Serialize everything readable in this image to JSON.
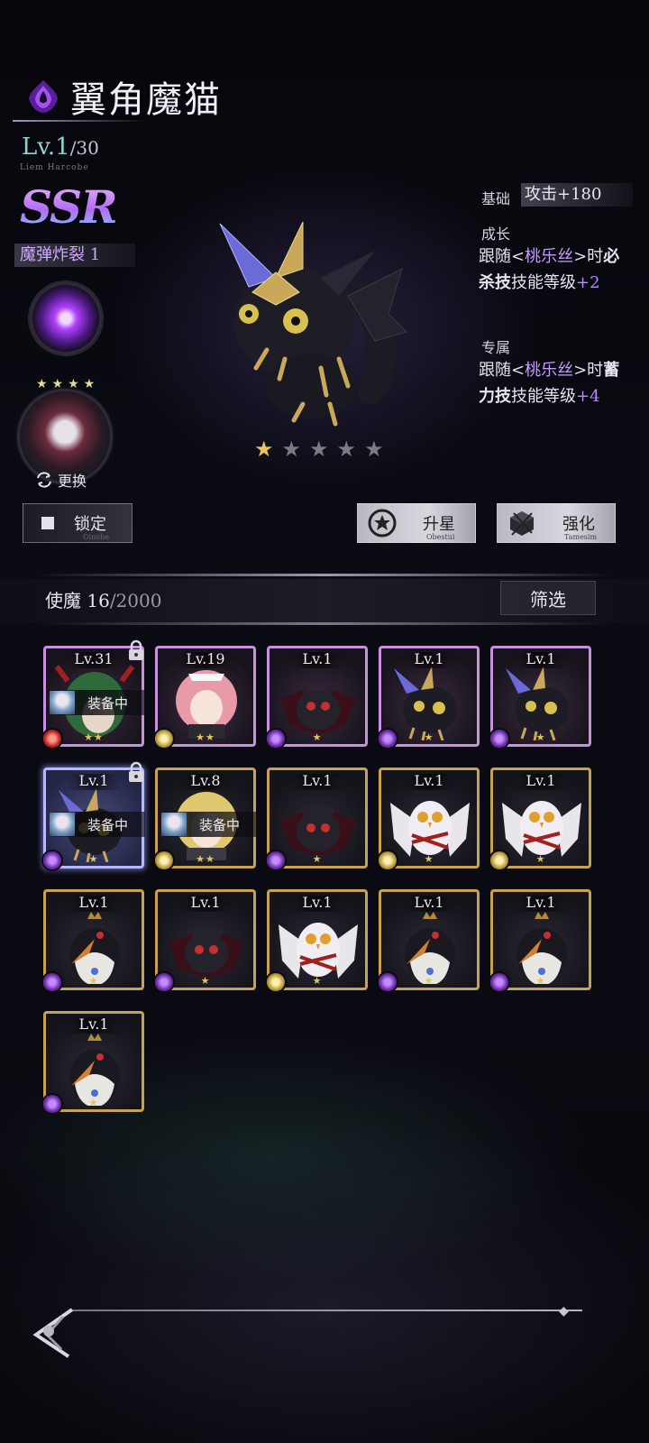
{
  "header": {
    "title": "翼角魔猫",
    "level": "Lv.1",
    "level_max": "/30",
    "subname": "Liem Harcobe",
    "rarity": "SSR",
    "skill_name": "魔弹炸裂 1"
  },
  "owner": {
    "stars": "★★★★",
    "change_label": "更换",
    "change_icon": "swap-icon"
  },
  "stats": {
    "base_label": "基础",
    "base_value": "攻击+180",
    "growth_label": "成长",
    "growth_pre": "跟随<",
    "growth_name": "桃乐丝",
    "growth_mid": ">时",
    "growth_bold1": "必",
    "growth_bold2": "杀技",
    "growth_post": "技能等级",
    "growth_bonus": "+2",
    "excl_label": "专属",
    "excl_pre": "跟随<",
    "excl_name": "桃乐丝",
    "excl_mid": ">时",
    "excl_bold1": "蓄",
    "excl_bold2": "力技",
    "excl_post": "技能等级",
    "excl_bonus": "+4"
  },
  "hero": {
    "stars_filled": 1,
    "stars_total": 5,
    "star_glyph": "★"
  },
  "actions": {
    "lock_label": "锁定",
    "lock_sub": "Oinobe",
    "upgrade_label": "升星",
    "upgrade_sub": "Obestui",
    "enhance_label": "强化",
    "enhance_sub": "Tamesim"
  },
  "list": {
    "title": "使魔",
    "count": "16",
    "max": "/2000",
    "filter_label": "筛选",
    "equip_label": "装备中",
    "cards": [
      {
        "lv": "Lv.31",
        "stars": "★★",
        "type": "fire",
        "frame": "purple",
        "art": "girl-green",
        "locked": true,
        "equip": true
      },
      {
        "lv": "Lv.19",
        "stars": "★★",
        "type": "light",
        "frame": "purple",
        "art": "maid",
        "locked": false,
        "equip": false
      },
      {
        "lv": "Lv.1",
        "stars": "★",
        "type": "dark",
        "frame": "purple",
        "art": "bat",
        "locked": false,
        "equip": false
      },
      {
        "lv": "Lv.1",
        "stars": "★",
        "type": "dark",
        "frame": "purple",
        "art": "cat",
        "locked": false,
        "equip": false
      },
      {
        "lv": "Lv.1",
        "stars": "★",
        "type": "dark",
        "frame": "purple",
        "art": "cat",
        "locked": false,
        "equip": false
      },
      {
        "lv": "Lv.1",
        "stars": "★",
        "type": "dark",
        "frame": "selected",
        "art": "cat",
        "locked": true,
        "equip": true
      },
      {
        "lv": "Lv.8",
        "stars": "★★",
        "type": "light",
        "frame": "gold",
        "art": "blonde",
        "locked": false,
        "equip": true
      },
      {
        "lv": "Lv.1",
        "stars": "★",
        "type": "dark",
        "frame": "gold",
        "art": "bat",
        "locked": false,
        "equip": false
      },
      {
        "lv": "Lv.1",
        "stars": "★",
        "type": "light",
        "frame": "gold",
        "art": "owl",
        "locked": false,
        "equip": false
      },
      {
        "lv": "Lv.1",
        "stars": "★",
        "type": "light",
        "frame": "gold",
        "art": "owl",
        "locked": false,
        "equip": false
      },
      {
        "lv": "Lv.1",
        "stars": "★",
        "type": "dark",
        "frame": "gold",
        "art": "crow",
        "locked": false,
        "equip": false
      },
      {
        "lv": "Lv.1",
        "stars": "★",
        "type": "dark",
        "frame": "gold",
        "art": "bat",
        "locked": false,
        "equip": false
      },
      {
        "lv": "Lv.1",
        "stars": "★",
        "type": "light",
        "frame": "gold",
        "art": "owl",
        "locked": false,
        "equip": false
      },
      {
        "lv": "Lv.1",
        "stars": "★",
        "type": "dark",
        "frame": "gold",
        "art": "crow",
        "locked": false,
        "equip": false
      },
      {
        "lv": "Lv.1",
        "stars": "★",
        "type": "dark",
        "frame": "gold",
        "art": "crow",
        "locked": false,
        "equip": false
      },
      {
        "lv": "Lv.1",
        "stars": "★",
        "type": "dark",
        "frame": "gold",
        "art": "crow",
        "locked": false,
        "equip": false
      }
    ]
  },
  "colors": {
    "accent_purple": "#c79aff",
    "gold_frame": "#c9a24e",
    "teal_level": "#8fd2cc"
  }
}
